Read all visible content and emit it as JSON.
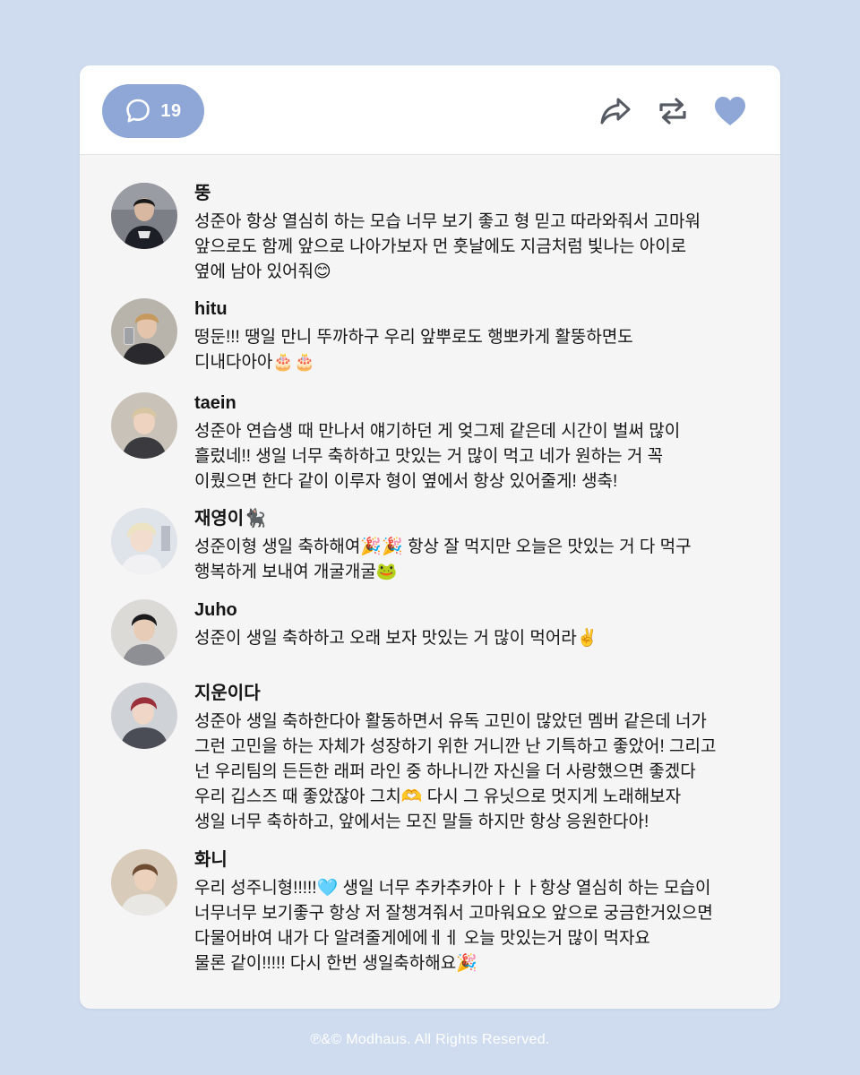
{
  "colors": {
    "page_background": "#cfdcef",
    "accent": "#8ea7d6",
    "card_background": "#f5f5f5"
  },
  "header": {
    "comment_count": "19",
    "icons": [
      "speech-bubble-icon",
      "share-arrow-icon",
      "repost-icon",
      "heart-icon"
    ]
  },
  "comments": [
    {
      "username": "뚱",
      "text": "성준아 항상 열심히 하는 모습 너무 보기 좋고 형 믿고 따라와줘서 고마워\n앞으로도 함께 앞으로 나아가보자 먼 훗날에도 지금처럼 빛나는 아이로\n옆에 남아 있어줘😊"
    },
    {
      "username": "hitu",
      "text": "떵둔!!! 땡일 만니 뚜까하구 우리 앞뿌로도 행뽀카게 활뚱하면도\n디내다아아🎂🎂"
    },
    {
      "username": "taein",
      "text": "성준아 연습생 때 만나서 얘기하던 게 엊그제 같은데 시간이 벌써 많이\n흘렀네!! 생일 너무 축하하고 맛있는 거 많이 먹고 네가 원하는 거 꼭\n이뤘으면 한다 같이 이루자 형이 옆에서 항상 있어줄게! 생축!"
    },
    {
      "username": "재영이🐈‍⬛",
      "text": "성준이형 생일 축하해여🎉🎉 항상 잘 먹지만 오늘은 맛있는 거 다 먹구\n행복하게 보내여 개굴개굴🐸"
    },
    {
      "username": "Juho",
      "text": "성준이 생일 축하하고 오래 보자 맛있는 거 많이 먹어라✌️"
    },
    {
      "username": "지운이다",
      "text": "성준아 생일 축하한다아 활동하면서 유독 고민이 많았던 멤버 같은데 너가\n그런 고민을 하는 자체가 성장하기 위한 거니깐 난 기특하고 좋았어! 그리고\n넌 우리팀의 든든한 래퍼 라인 중 하나니깐 자신을 더 사랑했으면 좋겠다\n우리 깁스즈 때 좋았잖아 그치🫶 다시 그 유닛으로 멋지게 노래해보자\n생일 너무 축하하고, 앞에서는 모진 말들 하지만 항상 응원한다아!"
    },
    {
      "username": "화니",
      "text": "우리 성주니형!!!!!🩵 생일 너무 추카추카아ㅏㅏㅏ항상 열심히 하는 모습이\n너무너무 보기좋구 항상 저 잘챙겨줘서 고마워요오 앞으로 궁금한거있으면\n다물어바여 내가 다 알려줄게에에ㅔㅔ 오늘 맛있는거 많이 먹자요\n물론 같이!!!!! 다시 한번 생일축하해요🎉"
    }
  ],
  "footer": {
    "copyright": "℗&© Modhaus. All Rights Reserved."
  }
}
